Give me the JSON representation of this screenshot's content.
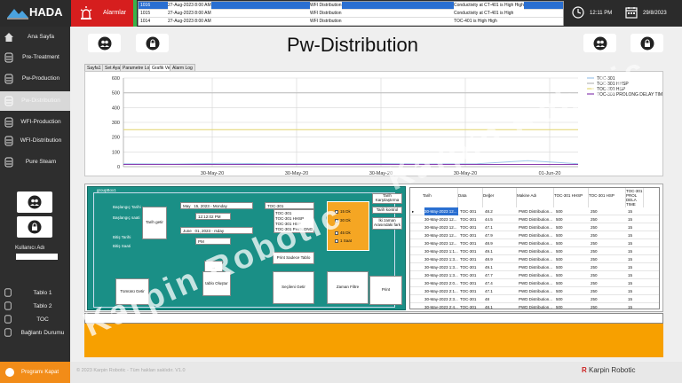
{
  "header": {
    "logo": "HADA",
    "alarm_label": "Alarmlar",
    "time": "12:11 PM",
    "date": "29/8/2023",
    "alarm_rows": [
      {
        "id": "1016",
        "time": "27-Aug-2023 8:00 AM",
        "area": "WFI Distribution",
        "message": "Conductivity at CT-401 is High High"
      },
      {
        "id": "1015",
        "time": "27-Aug-2023 8:00 AM",
        "area": "WFI Distribution",
        "message": "Conductivity at CT-401 is High"
      },
      {
        "id": "1014",
        "time": "27-Aug-2023 8:00 AM",
        "area": "WFI Distribution",
        "message": "TOC-401 is High High"
      }
    ]
  },
  "sidebar": {
    "items": [
      {
        "label": "Ana Sayfa",
        "icon": "home-icon"
      },
      {
        "label": "Pre-Treatment",
        "icon": "tank-icon"
      },
      {
        "label": "Pw-Production",
        "icon": "tank-icon"
      },
      {
        "label": "Pw-Distribution",
        "icon": "tank-icon"
      },
      {
        "label": "WFI-Production",
        "icon": "tank-icon"
      },
      {
        "label": "WFI-Distribution",
        "icon": "tank-icon"
      },
      {
        "label": "Pure Steam",
        "icon": "tank-icon"
      }
    ],
    "kullanici_label": "Kullanıcı Adı",
    "bottom_items": [
      {
        "label": "Tablo 1"
      },
      {
        "label": "Tablo 2"
      },
      {
        "label": "TOC"
      },
      {
        "label": "Bağlantı Durumu"
      }
    ]
  },
  "page": {
    "title": "Pw-Distribution",
    "tabs": [
      "Sayfa1",
      "Set Ayar",
      "Parametre Log",
      "Grafik Veri",
      "Alarm Log"
    ],
    "active_tab": 3
  },
  "chart_data": {
    "type": "line",
    "ylim": [
      0,
      600
    ],
    "yticks": [
      "600",
      "500",
      "400",
      "300",
      "200",
      "100",
      "0"
    ],
    "xticks": [
      "30-May-20",
      "30-May-20",
      "30-May-20",
      "30-May-20",
      "01-Jun-20"
    ],
    "legend_position": "top-right",
    "series": [
      {
        "name": "TOC-301",
        "color": "#9ec5e8",
        "values": [
          20,
          18,
          22,
          20,
          19,
          21,
          18,
          20,
          40,
          20
        ]
      },
      {
        "name": "TOC-301 HHSP",
        "color": "#b9b9b9",
        "values": [
          500,
          500,
          500,
          500,
          500,
          500,
          500,
          500,
          500,
          500
        ]
      },
      {
        "name": "TOC-301 HSP",
        "color": "#e2d46b",
        "values": [
          250,
          250,
          250,
          250,
          250,
          250,
          250,
          250,
          250,
          250
        ]
      },
      {
        "name": "TOC-301 PROLONG DELAY TIMER",
        "color": "#8a3fb0",
        "values": [
          15,
          15,
          15,
          15,
          15,
          15,
          15,
          15,
          15,
          15
        ]
      }
    ]
  },
  "filter": {
    "group_title": "groupBox1",
    "baslangic_tarihi": "Başlangıç Tarihi",
    "baslangic_saati": "Başlangıç saati",
    "bitis_tarihi": "Bitiş Tarihi",
    "bitis_saati": "Bitiş Saati",
    "tarih_getir": "Tarih getir",
    "start_date": [
      "May",
      "15, 2023 -",
      "Monday"
    ],
    "start_time": "12:12:02 PM",
    "end_date": [
      "June",
      "01, 2023 -",
      "rsday"
    ],
    "end_time": "PM",
    "select_value": "TOC-301",
    "list_items": [
      "TOC-301",
      "TOC-301 HHSP",
      "TOC-301 HSP",
      "TOC-301 PROLONG"
    ],
    "checks": [
      "15 Dk",
      "30 Dk",
      "45 Dk",
      "1 Saat"
    ],
    "print_btn": "Print Sadece Tablo",
    "secileni_getir": "Seçileni Getir",
    "zaman_filtre": "Zaman Filtre",
    "tablo_olustur": "tablo Oluştur",
    "tumunu_getir": "Tümünü Getir",
    "tarih_karsilastirma": "Tarih Karşılaştırma",
    "tarih_kontrol": "Tarih kontrol",
    "iki_zaman": "İki zaman Arasındaki fark",
    "print": "Print",
    "arrow_btn": "→"
  },
  "table": {
    "columns": [
      "Tarih",
      "Data",
      "Değer",
      "Makine Adı",
      "TOC-301 HHSP",
      "TOC-301 HSP",
      "TOC-301 PROL DELA TIME"
    ],
    "rows": [
      [
        "30-May-2023 12...",
        "TOC-301",
        "48.2",
        "PWD Distribution...",
        "500",
        "250",
        "15"
      ],
      [
        "30-May-2023 12...",
        "TOC-301",
        "44.5",
        "PWD Distribution...",
        "500",
        "250",
        "15"
      ],
      [
        "30-May-2023 12...",
        "TOC-301",
        "47.1",
        "PWD Distribution...",
        "500",
        "250",
        "15"
      ],
      [
        "30-May-2023 12...",
        "TOC-301",
        "47.9",
        "PWD Distribution...",
        "500",
        "250",
        "15"
      ],
      [
        "30-May-2023 12...",
        "TOC-301",
        "48.9",
        "PWD Distribution...",
        "500",
        "250",
        "15"
      ],
      [
        "30-May-2023 1:1...",
        "TOC-301",
        "49.1",
        "PWD Distribution...",
        "500",
        "250",
        "15"
      ],
      [
        "30-May-2023 1:3...",
        "TOC-301",
        "48.9",
        "PWD Distribution...",
        "500",
        "250",
        "15"
      ],
      [
        "30-May-2023 1:3...",
        "TOC-301",
        "49.1",
        "PWD Distribution...",
        "500",
        "250",
        "15"
      ],
      [
        "30-May-2023 1:3...",
        "TOC-301",
        "47.7",
        "PWD Distribution...",
        "500",
        "250",
        "15"
      ],
      [
        "30-May-2023 2:0...",
        "TOC-301",
        "47.4",
        "PWD Distribution...",
        "500",
        "250",
        "15"
      ],
      [
        "30-May-2023 2:1...",
        "TOC-301",
        "47.1",
        "PWD Distribution...",
        "500",
        "250",
        "15"
      ],
      [
        "30-May-2023 2:3...",
        "TOC-301",
        "48",
        "PWD Distribution...",
        "500",
        "250",
        "15"
      ],
      [
        "30-May-2023 2:4...",
        "TOC-301",
        "48.1",
        "PWD Distribution...",
        "500",
        "250",
        "15"
      ]
    ]
  },
  "footer": {
    "exit_label": "Programı Kapat",
    "copyright": "© 2023 Karpin Robotic - Tüm hakları saklıdır. V1.0",
    "brand_r": "R",
    "brand": "Karpin Robotic"
  },
  "watermarks": [
    "Karpin Robotic",
    "Karpin Robotic"
  ]
}
